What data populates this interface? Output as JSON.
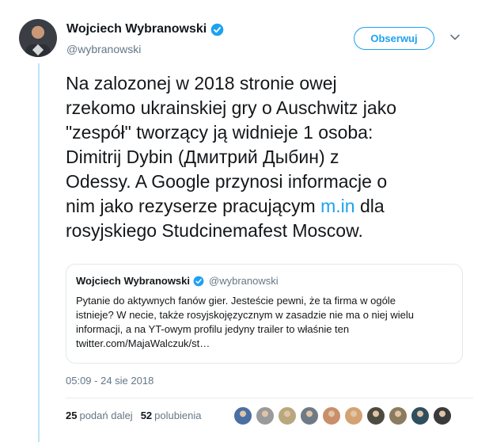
{
  "user": {
    "name": "Wojciech Wybranowski",
    "handle": "@wybranowski",
    "follow_label": "Obserwuj"
  },
  "tweet": {
    "lines": [
      "Na zalozonej w 2018  stronie owej",
      "rzekomo ukrainskiej gry o Auschwitz jako",
      "\"zespół\" tworzący ją widnieje 1 osoba:",
      "Dimitrij Dybin (Дмитрий Дыбин) z",
      "Odessy.  A Google przynosi informacje o"
    ],
    "line6_before": "nim jako rezyserze pracującym ",
    "line6_link": "m.in",
    "line6_after": " dla",
    "line7": "rosyjskiego Studcinemafest Moscow."
  },
  "quote": {
    "name": "Wojciech Wybranowski",
    "handle": "@wybranowski",
    "lines": [
      "Pytanie do aktywnych fanów gier. Jesteście pewni, że ta firma w ogóle",
      "istnieje? W necie, także rosyjskojęzycznym w zasadzie nie ma o niej wielu",
      "informacji, a na YT-owym profilu jedyny trailer to właśnie ten",
      "twitter.com/MajaWalczuk/st…"
    ]
  },
  "timestamp": "05:09 - 24 sie 2018",
  "stats": {
    "retweets_count": "25",
    "retweets_label": "podań dalej",
    "likes_count": "52",
    "likes_label": "polubienia"
  },
  "likers": [
    {
      "color": "#4a6fa5"
    },
    {
      "color": "#9a9a9a"
    },
    {
      "color": "#b9a77e"
    },
    {
      "color": "#6e7b86"
    },
    {
      "color": "#c98f6a"
    },
    {
      "color": "#d4a373"
    },
    {
      "color": "#4d4a3f"
    },
    {
      "color": "#8c7b5e"
    },
    {
      "color": "#2f4f5f"
    },
    {
      "color": "#3a3a3a"
    }
  ],
  "colors": {
    "accent": "#1da1f2",
    "thread_line": "#bde3f9"
  }
}
